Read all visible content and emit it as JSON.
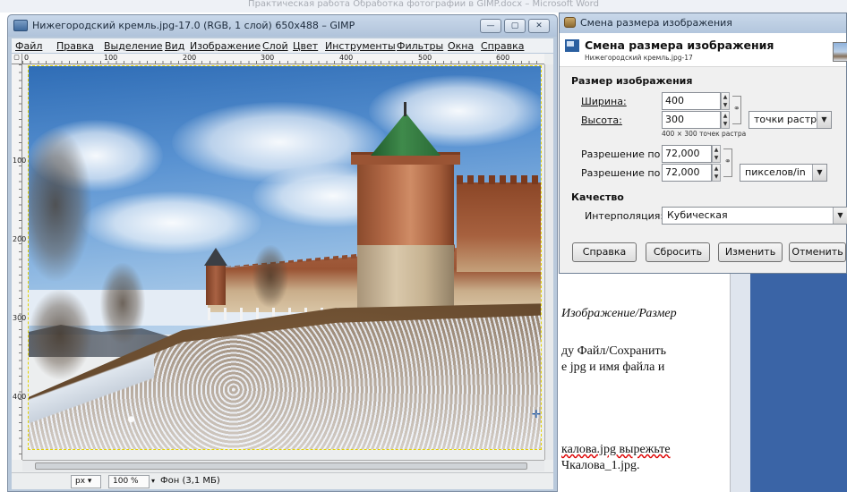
{
  "word": {
    "title": "Практическая работа Обработка фотографии в GIMP.docx – Microsoft Word",
    "lines": [
      "Изображение/Размер",
      "ду Файл/Сохранить",
      "е jpg и имя файла и",
      "калова.jpg вырежьте",
      "Чкалова_1.jpg."
    ]
  },
  "gimp": {
    "title": "Нижегородский кремль.jpg-17.0 (RGB, 1 слой) 650x488 – GIMP",
    "menu": [
      "Файл",
      "Правка",
      "Выделение",
      "Вид",
      "Изображение",
      "Слой",
      "Цвет",
      "Инструменты",
      "Фильтры",
      "Окна",
      "Справка"
    ],
    "ruler_top": [
      "0",
      "100",
      "200",
      "300",
      "400",
      "500",
      "600"
    ],
    "ruler_left": [
      "100",
      "200",
      "300",
      "400"
    ],
    "status": {
      "unit": "px",
      "zoom": "100 %",
      "layer_info": "Фон (3,1 МБ)"
    }
  },
  "dialog": {
    "window_title": "Смена размера изображения",
    "header_title": "Смена размера изображения",
    "header_subtitle": "Нижегородский кремль.jpg-17",
    "section_size": "Размер изображения",
    "width_label": "Ширина:",
    "width_value": "400",
    "height_label": "Высота:",
    "height_value": "300",
    "size_unit": "точки растра",
    "size_note": "400 × 300 точек растра",
    "res_x_label": "Разрешение по X:",
    "res_x_value": "72,000",
    "res_y_label": "Разрешение по Y:",
    "res_y_value": "72,000",
    "res_unit": "пикселов/in",
    "section_quality": "Качество",
    "interp_label": "Интерполяция:",
    "interp_value": "Кубическая",
    "buttons": {
      "help": "Справка",
      "reset": "Сбросить",
      "scale": "Изменить",
      "cancel": "Отменить"
    }
  }
}
